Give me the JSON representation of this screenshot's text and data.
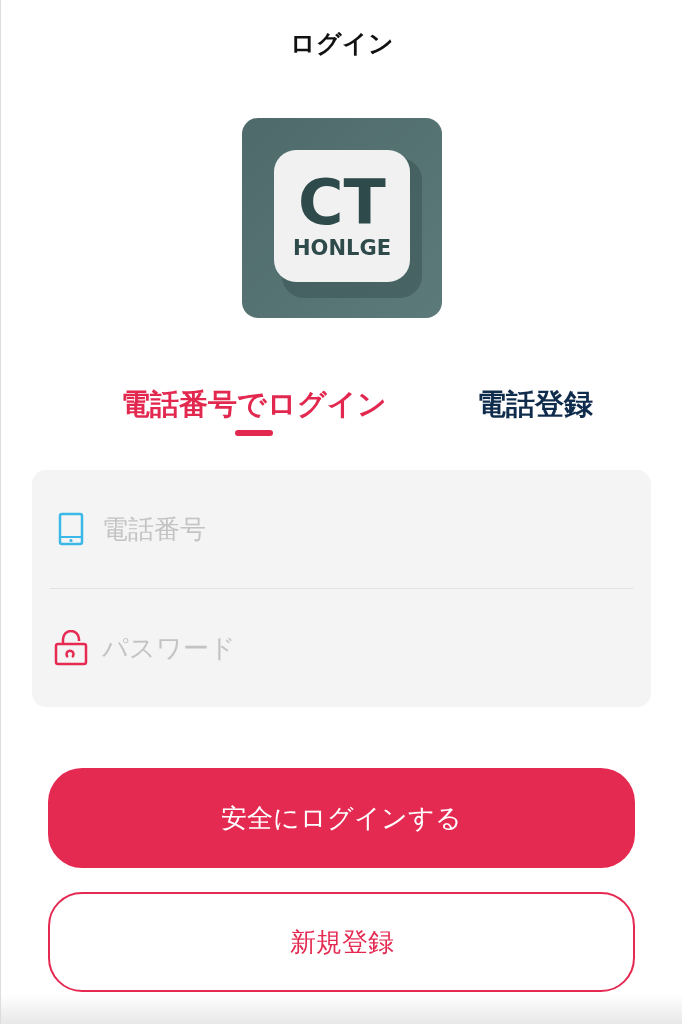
{
  "header": {
    "title": "ログイン"
  },
  "logo": {
    "mark": "CT",
    "name": "HONLGE"
  },
  "tabs": [
    {
      "label": "電話番号でログイン",
      "selected": true
    },
    {
      "label": "電話登録",
      "selected": false
    }
  ],
  "fields": [
    {
      "kind": "phone",
      "placeholder": "電話番号"
    },
    {
      "kind": "password",
      "placeholder": "パスワード"
    }
  ],
  "buttons": [
    {
      "kind": "primary",
      "label": "安全にログインする"
    },
    {
      "kind": "outline",
      "label": "新規登録"
    }
  ]
}
